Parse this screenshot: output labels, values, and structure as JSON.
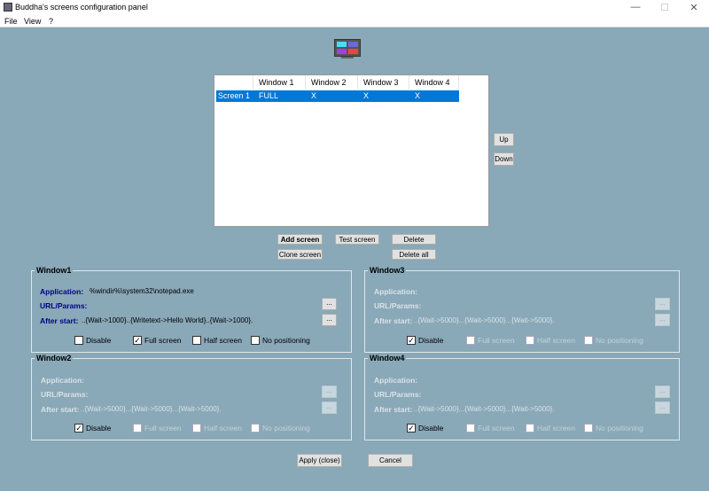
{
  "window": {
    "title": "Buddha's screens configuration panel",
    "controls": [
      "—",
      "☐",
      "✕"
    ]
  },
  "menu": [
    "File",
    "View",
    "?"
  ],
  "grid": {
    "columns": [
      "",
      "Window 1",
      "Window 2",
      "Window 3",
      "Window 4"
    ],
    "rows": [
      [
        "Screen 1",
        "FULL",
        "X",
        "X",
        "X"
      ]
    ]
  },
  "buttons": {
    "up": "Up",
    "down": "Down",
    "add": "Add screen",
    "test": "Test screen",
    "delete": "Delete",
    "clone": "Clone screen",
    "delete_all": "Delete all",
    "apply": "Apply (close)",
    "cancel": "Cancel",
    "dots": "..."
  },
  "labels": {
    "application": "Application:",
    "url": "URL/Params:",
    "after": "After start:",
    "disable": "Disable",
    "full": "Full screen",
    "half": "Half screen",
    "nopos": "No positioning"
  },
  "groups": {
    "w1": {
      "title": "Window1",
      "application": "%windir%\\system32\\notepad.exe",
      "url": "",
      "after": "..{Wait->1000}..{Writetext->Hello World}..{Wait->1000}.",
      "disable": false,
      "full": true,
      "half": false,
      "nopos": false
    },
    "w2": {
      "title": "Window2",
      "application": "",
      "url": "",
      "after": "..{Wait->5000}...{Wait->5000}...{Wait->5000}.",
      "disable": true,
      "full": false,
      "half": false,
      "nopos": false
    },
    "w3": {
      "title": "Window3",
      "application": "",
      "url": "",
      "after": "..{Wait->5000}...{Wait->5000}...{Wait->5000}.",
      "disable": true,
      "full": false,
      "half": false,
      "nopos": false
    },
    "w4": {
      "title": "Window4",
      "application": "",
      "url": "",
      "after": "..{Wait->5000}...{Wait->5000}...{Wait->5000}.",
      "disable": true,
      "full": false,
      "half": false,
      "nopos": false
    }
  }
}
